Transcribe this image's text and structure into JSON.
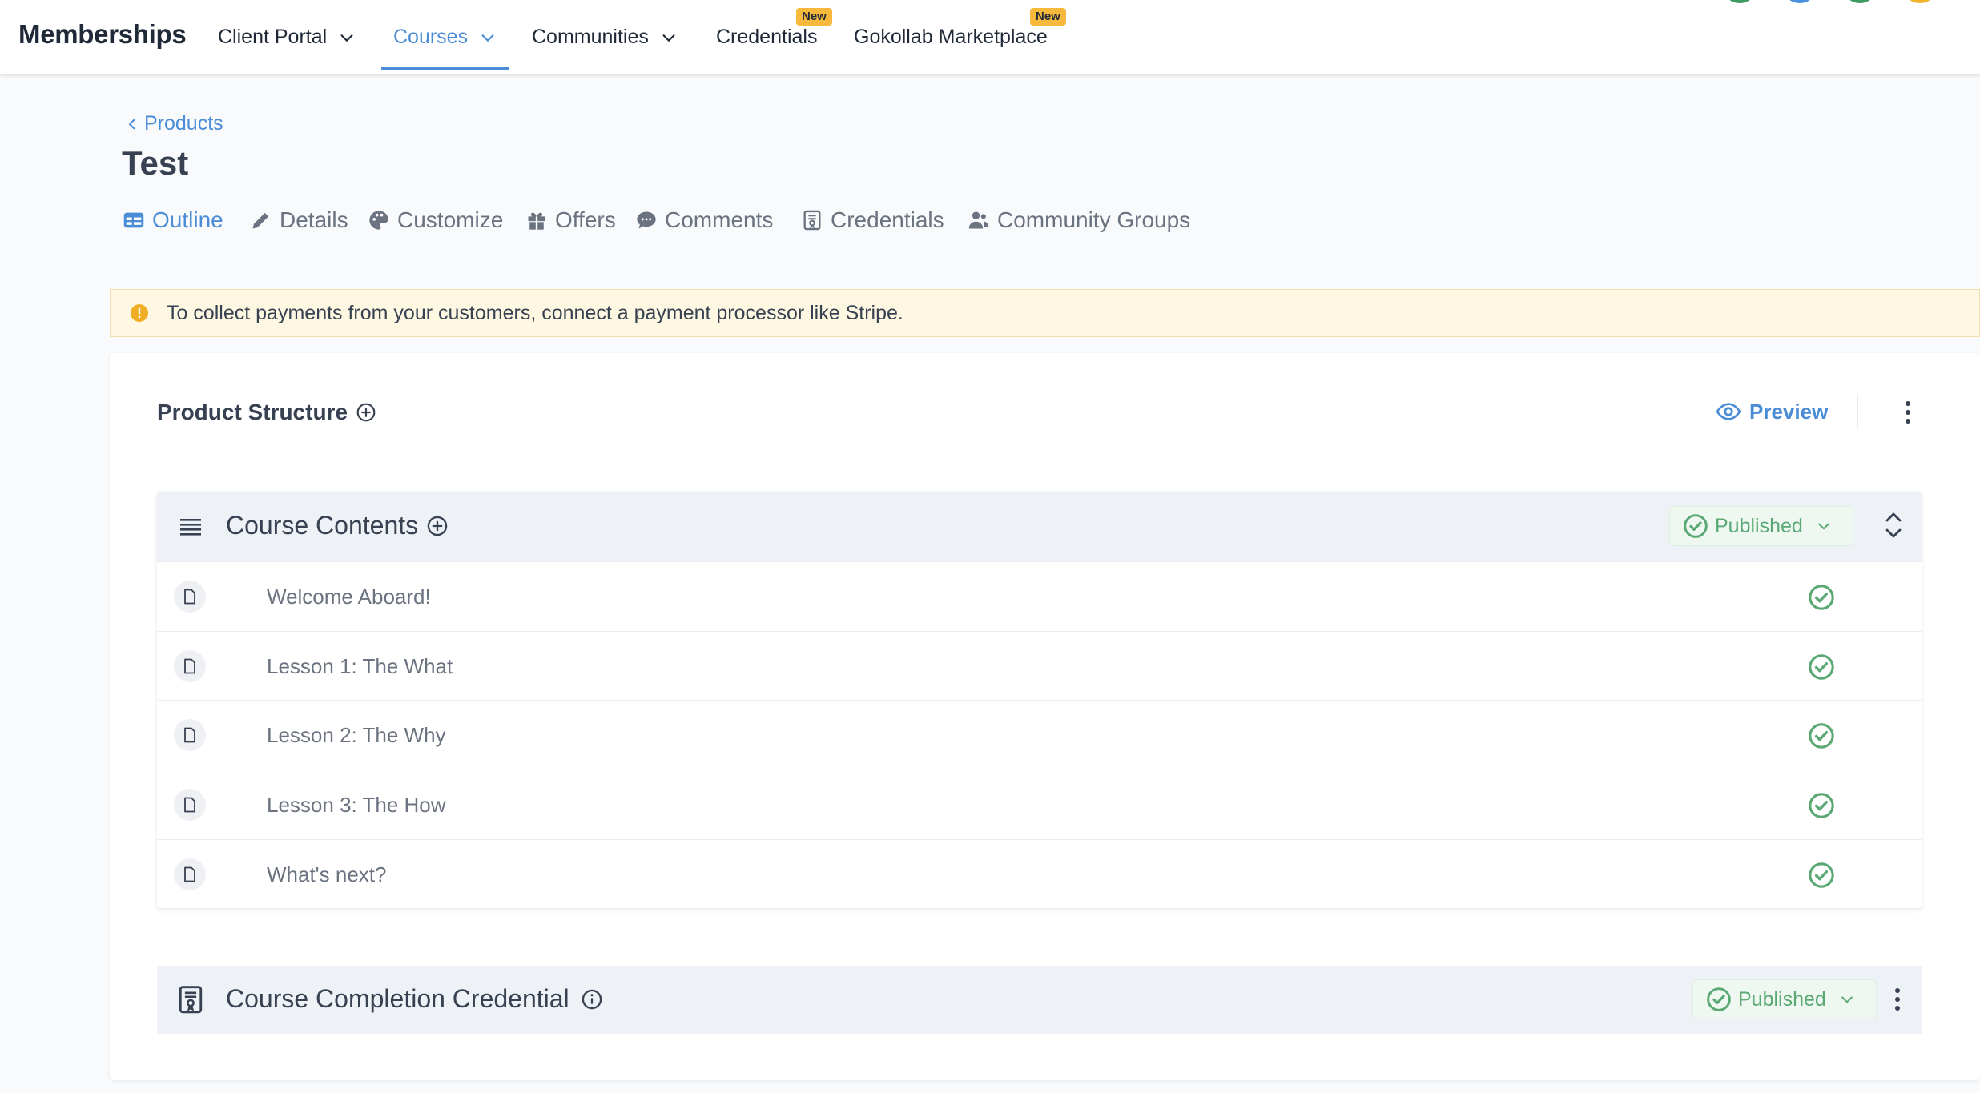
{
  "app": {
    "brand": "Memberships",
    "nav": [
      {
        "label": "Client Portal",
        "has_dropdown": true
      },
      {
        "label": "Courses",
        "has_dropdown": true,
        "active": true
      },
      {
        "label": "Communities",
        "has_dropdown": true
      },
      {
        "label": "Credentials",
        "badge": "New"
      },
      {
        "label": "Gokollab Marketplace",
        "badge": "New"
      }
    ]
  },
  "breadcrumb": {
    "back_label": "Products"
  },
  "page": {
    "title": "Test"
  },
  "tabs": [
    {
      "label": "Outline",
      "icon": "table-icon",
      "active": true
    },
    {
      "label": "Details",
      "icon": "pencil-icon"
    },
    {
      "label": "Customize",
      "icon": "palette-icon"
    },
    {
      "label": "Offers",
      "icon": "gift-icon"
    },
    {
      "label": "Comments",
      "icon": "chat-bubble-icon"
    },
    {
      "label": "Credentials",
      "icon": "certificate-icon"
    },
    {
      "label": "Community Groups",
      "icon": "users-icon"
    }
  ],
  "alert": {
    "text": "To collect payments from your customers, connect a payment processor like Stripe.",
    "icon": "warning-icon"
  },
  "product_structure": {
    "title": "Product Structure",
    "preview_label": "Preview"
  },
  "course_contents": {
    "title": "Course Contents",
    "status": "Published",
    "lessons": [
      {
        "title": "Welcome Aboard!",
        "published": true
      },
      {
        "title": "Lesson 1: The What",
        "published": true
      },
      {
        "title": "Lesson 2: The Why",
        "published": true
      },
      {
        "title": "Lesson 3: The How",
        "published": true
      },
      {
        "title": "What's next?",
        "published": true
      }
    ]
  },
  "credential": {
    "title": "Course Completion Credential",
    "status": "Published"
  },
  "colors": {
    "accent": "#4a8dd6",
    "success": "#5aa874",
    "badge": "#f6b93b",
    "alert_bg": "#fef8e2"
  }
}
